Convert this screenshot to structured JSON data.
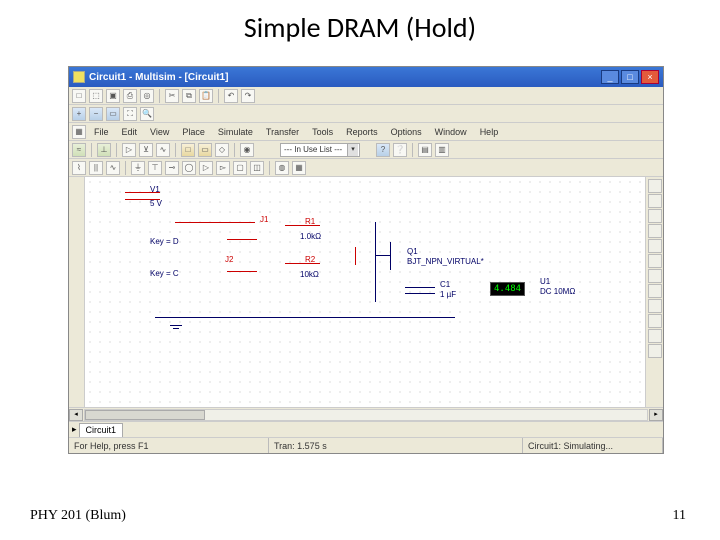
{
  "slide": {
    "title": "Simple DRAM (Hold)",
    "footer_left": "PHY 201 (Blum)",
    "page_number": "11"
  },
  "window": {
    "title": "Circuit1 - Multisim - [Circuit1]",
    "controls": {
      "min": "_",
      "max": "□",
      "close": "×"
    }
  },
  "menubar": {
    "items": [
      "File",
      "Edit",
      "View",
      "Place",
      "Simulate",
      "Transfer",
      "Tools",
      "Reports",
      "Options",
      "Window",
      "Help"
    ]
  },
  "toolbar3": {
    "inuse_label": "--- In Use List ---"
  },
  "tab": {
    "label": "Circuit1"
  },
  "statusbar": {
    "help": "For Help, press F1",
    "tran": "Tran: 1.575 s",
    "state": "Circuit1: Simulating..."
  },
  "circuit": {
    "v1": "V1",
    "v1val": "5 V",
    "j1": "J1",
    "j1key": "Key = D",
    "j2": "J2",
    "j2key": "Key = C",
    "r1": "R1",
    "r1val": "1.0kΩ",
    "r2": "R2",
    "r2val": "10kΩ",
    "q1": "Q1",
    "q1type": "BJT_NPN_VIRTUAL*",
    "c1": "C1",
    "c1val": "1 µF",
    "u1": "U1",
    "u1val": "DC  10MΩ",
    "meter": "4.484"
  }
}
